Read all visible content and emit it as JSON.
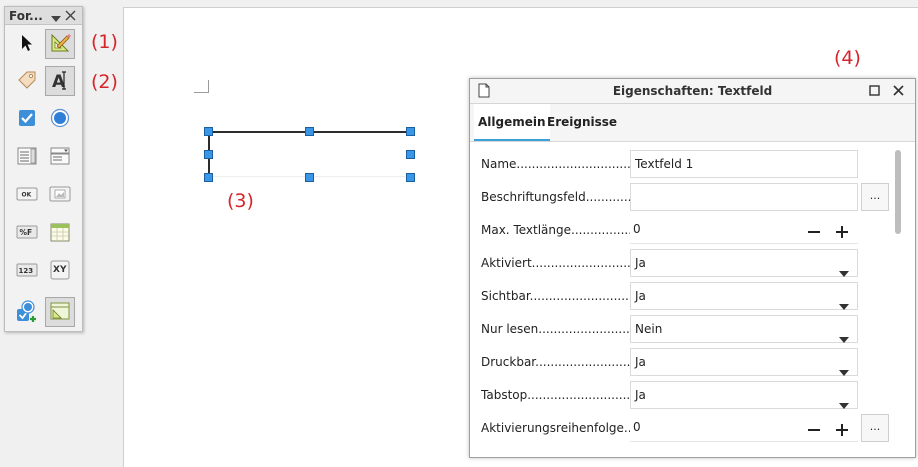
{
  "toolbar": {
    "title": "For...",
    "buttons": [
      {
        "icon": "pointer-select-icon",
        "active": false
      },
      {
        "icon": "design-mode-icon",
        "active": true
      },
      {
        "icon": "control-properties-icon",
        "active": false
      },
      {
        "icon": "text-box-icon",
        "active": true
      },
      {
        "icon": "check-box-icon",
        "active": false
      },
      {
        "icon": "option-button-icon",
        "active": false
      },
      {
        "icon": "list-box-icon",
        "active": false
      },
      {
        "icon": "combo-box-icon",
        "active": false
      },
      {
        "icon": "push-button-icon",
        "active": false
      },
      {
        "icon": "image-button-icon",
        "active": false
      },
      {
        "icon": "formatted-field-icon",
        "active": false
      },
      {
        "icon": "date-field-icon",
        "active": false
      },
      {
        "icon": "numerical-field-icon",
        "active": false
      },
      {
        "icon": "table-control-icon",
        "active": false
      },
      {
        "icon": "more-controls-icon",
        "active": false
      },
      {
        "icon": "form-design-icon",
        "active": true
      }
    ]
  },
  "annotations": {
    "a1": "(1)",
    "a2": "(2)",
    "a3": "(3)",
    "a4": "(4)"
  },
  "dialog": {
    "title": "Eigenschaften: Textfeld",
    "tabs": [
      {
        "label": "Allgemein",
        "active": true
      },
      {
        "label": "Ereignisse",
        "active": false
      }
    ],
    "properties": [
      {
        "label": "Name.......................................",
        "value": "Textfeld 1",
        "kind": "text"
      },
      {
        "label": "Beschriftungsfeld....................",
        "value": "",
        "kind": "text-button",
        "button": "..."
      },
      {
        "label": "Max. Textlänge......................",
        "value": "0",
        "kind": "spin"
      },
      {
        "label": "Aktiviert..................................",
        "value": "Ja",
        "kind": "dropdown"
      },
      {
        "label": "Sichtbar...................................",
        "value": "Ja",
        "kind": "dropdown"
      },
      {
        "label": "Nur lesen................................",
        "value": "Nein",
        "kind": "dropdown"
      },
      {
        "label": "Druckbar..................................",
        "value": "Ja",
        "kind": "dropdown"
      },
      {
        "label": "Tabstop....................................",
        "value": "Ja",
        "kind": "dropdown"
      },
      {
        "label": "Aktivierungsreihenfolge.....",
        "value": "0",
        "kind": "spin-button",
        "button": "..."
      }
    ]
  },
  "colors": {
    "annotation": "#d6242b",
    "handle": "#3a97e8",
    "tab_underline": "#39a0d9"
  }
}
